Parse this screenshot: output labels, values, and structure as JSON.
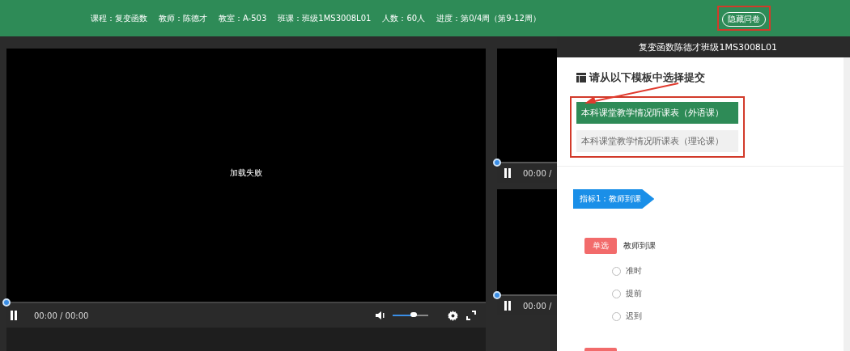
{
  "top_bar": {
    "info": [
      "课程：复变函数",
      "教师：陈德才",
      "教室：A-503",
      "班课：班级1MS3008L01",
      "人数：60人",
      "进度：第0/4周（第9-12周）"
    ],
    "hide_button": "隐藏问卷"
  },
  "main_video": {
    "message": "加载失败",
    "progress": {
      "level": 0
    },
    "time": "00:00 / 00:00",
    "volume": {
      "level": 0.6
    }
  },
  "side_videos": [
    {
      "time": "00:00 /",
      "progress": {
        "level": 0
      }
    },
    {
      "time": "00:00 /",
      "progress": {
        "level": 0
      }
    }
  ],
  "panel": {
    "title": "复变函数陈德才班级1MS3008L01",
    "heading": "请从以下模板中选择提交",
    "templates": [
      {
        "label": "本科课堂教学情况听课表（外语课）",
        "selected": true
      },
      {
        "label": "本科课堂教学情况听课表（理论课）",
        "selected": false
      }
    ],
    "indicator": "指标1：教师到课",
    "question": {
      "type": "单选",
      "text": "教师到课",
      "options": [
        {
          "label": "准时",
          "selected": false
        },
        {
          "label": "提前",
          "selected": false
        },
        {
          "label": "迟到",
          "selected": false
        }
      ]
    }
  }
}
